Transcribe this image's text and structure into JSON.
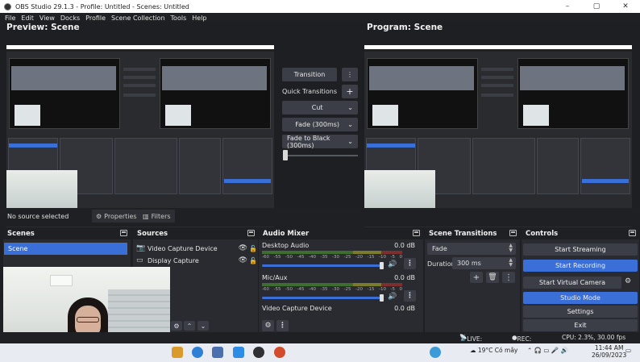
{
  "window": {
    "title": "OBS Studio 29.1.3 - Profile: Untitled - Scenes: Untitled",
    "controls": [
      "–",
      "▢",
      "✕"
    ]
  },
  "menu": [
    "File",
    "Edit",
    "View",
    "Docks",
    "Profile",
    "Scene Collection",
    "Tools",
    "Help"
  ],
  "preview": {
    "title": "Preview: Scene"
  },
  "program": {
    "title": "Program: Scene"
  },
  "transitions_panel": {
    "transition_label": "Transition",
    "quick_transitions_label": "Quick Transitions",
    "options": [
      "Cut",
      "Fade (300ms)",
      "Fade to Black (300ms)"
    ]
  },
  "source_bar": {
    "no_source": "No source selected",
    "properties": "Properties",
    "filters": "Filters"
  },
  "docks": {
    "scenes": {
      "title": "Scenes",
      "items": [
        "Scene"
      ]
    },
    "sources": {
      "title": "Sources",
      "items": [
        "Video Capture Device",
        "Display Capture"
      ]
    },
    "mixer": {
      "title": "Audio Mixer",
      "scale": [
        "-60",
        "-55",
        "-50",
        "-45",
        "-40",
        "-35",
        "-30",
        "-25",
        "-20",
        "-15",
        "-10",
        "-5",
        "0"
      ],
      "channels": [
        {
          "name": "Desktop Audio",
          "db": "0.0 dB"
        },
        {
          "name": "Mic/Aux",
          "db": "0.0 dB"
        },
        {
          "name": "Video Capture Device",
          "db": "0.0 dB"
        }
      ]
    },
    "transitions": {
      "title": "Scene Transitions",
      "type": "Fade",
      "duration_label": "Duration",
      "duration": "300 ms"
    },
    "controls": {
      "title": "Controls",
      "buttons": [
        "Start Streaming",
        "Start Recording",
        "Start Virtual Camera",
        "Studio Mode",
        "Settings",
        "Exit"
      ]
    }
  },
  "status": {
    "live": "LIVE: 00:00:00",
    "rec": "REC: 00:00:00",
    "cpu": "CPU: 2.3%, 30.00 fps"
  },
  "taskbar": {
    "weather": "19°C  Có mây",
    "time": "11:44 AM",
    "date": "26/09/2023"
  },
  "colors": {
    "accent": "#3b6fd8",
    "dock_bg": "#2a2b30",
    "header_bg": "#1f2024",
    "button_bg": "#3b3e46"
  }
}
